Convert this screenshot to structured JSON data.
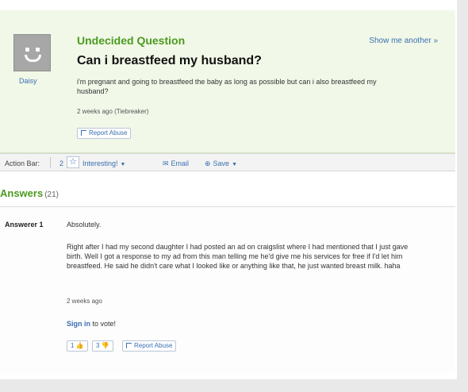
{
  "question": {
    "label": "Undecided Question",
    "show_more": "Show me another »",
    "asker": "Daisy",
    "title": "Can i breastfeed my husband?",
    "body": "i'm pregnant and going to breastfeed the baby as long as possible but can i also breastfeed my husband?",
    "meta": "2 weeks ago (Tiebreaker)",
    "report_label": "Report Abuse"
  },
  "action_bar": {
    "label": "Action Bar:",
    "interesting_count": "2",
    "interesting_label": "Interesting!",
    "email_label": "Email",
    "save_label": "Save"
  },
  "answers": {
    "heading": "Answers",
    "count": "(21)",
    "items": [
      {
        "answerer": "Answerer 1",
        "short": "Absolutely.",
        "body": "Right after I had my second daughter I had posted an ad on craigslist where I had mentioned that I just gave birth. Well I got a response to my ad from this man telling me he'd give me his services for free if I'd let him breastfeed. He said he didn't care what I looked like or anything like that, he just wanted breast milk. haha",
        "meta": "2 weeks ago",
        "sign_in_link": "Sign in",
        "sign_in_rest": " to vote!",
        "thumbs_up": "1",
        "thumbs_down": "3",
        "report_label": "Report Abuse"
      }
    ]
  },
  "icons": {
    "star": "☆",
    "email": "✉",
    "save": "⊕",
    "thumb_up": "👍",
    "thumb_down": "👎",
    "caret": "▼"
  },
  "colors": {
    "accent_green": "#4b9a1f",
    "link_blue": "#3a6fb2",
    "header_bg": "#f1f8e8"
  }
}
